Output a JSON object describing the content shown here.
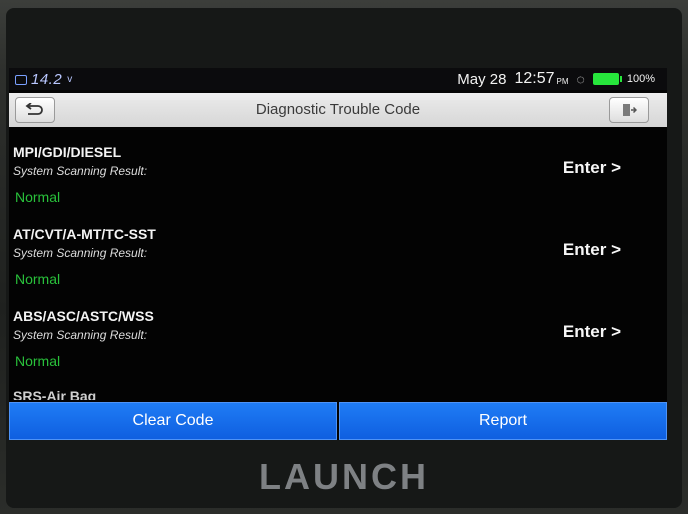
{
  "status_bar": {
    "voltage": "14.2",
    "voltage_unit": "v",
    "date": "May 28",
    "time": "12:57",
    "ampm": "PM",
    "battery": "100%"
  },
  "title_bar": {
    "title": "Diagnostic Trouble Code"
  },
  "systems": [
    {
      "name": "MPI/GDI/DIESEL",
      "sub": "System Scanning Result:",
      "status": "Normal",
      "enter": "Enter >"
    },
    {
      "name": "AT/CVT/A-MT/TC-SST",
      "sub": "System Scanning Result:",
      "status": "Normal",
      "enter": "Enter >"
    },
    {
      "name": "ABS/ASC/ASTC/WSS",
      "sub": "System Scanning Result:",
      "status": "Normal",
      "enter": "Enter >"
    }
  ],
  "partial_item": "SRS-Air Bag",
  "actions": {
    "clear_code": "Clear Code",
    "report": "Report"
  },
  "brand": "LAUNCH",
  "colors": {
    "normal_status": "#29c23b",
    "action_blue": "#1f7cf5",
    "battery_green": "#27e63c"
  }
}
